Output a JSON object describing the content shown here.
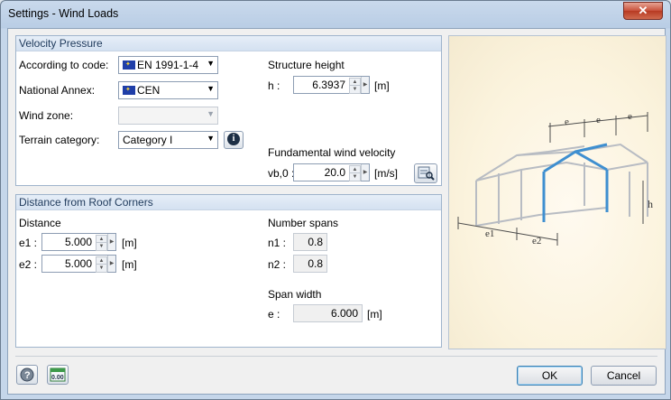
{
  "window": {
    "title": "Settings - Wind Loads",
    "close_glyph": "✕"
  },
  "velocity_pressure": {
    "header": "Velocity Pressure",
    "code_label": "According to code:",
    "code_value": "EN 1991-1-4",
    "annex_label": "National Annex:",
    "annex_value": "CEN",
    "zone_label": "Wind zone:",
    "zone_value": "",
    "terrain_label": "Terrain category:",
    "terrain_value": "Category I",
    "height_title": "Structure height",
    "h_label": "h :",
    "h_value": "6.3937",
    "h_unit": "[m]",
    "fund_title": "Fundamental wind velocity",
    "vb0_label": "vb,0 :",
    "vb0_value": "20.0",
    "vb0_unit": "[m/s]"
  },
  "roof_corners": {
    "header": "Distance from Roof Corners",
    "distance_title": "Distance",
    "e1_label": "e1 :",
    "e1_value": "5.000",
    "e1_unit": "[m]",
    "e2_label": "e2 :",
    "e2_value": "5.000",
    "e2_unit": "[m]",
    "spans_title": "Number spans",
    "n1_label": "n1 :",
    "n1_value": "0.8",
    "n2_label": "n2 :",
    "n2_value": "0.8",
    "span_width_title": "Span width",
    "e_label": "e :",
    "e_value": "6.000",
    "e_unit": "[m]"
  },
  "figure": {
    "e_top1": "e",
    "e_top2": "e",
    "e_top3": "e",
    "h": "h",
    "e1": "e1",
    "e2": "e2"
  },
  "buttons": {
    "ok": "OK",
    "cancel": "Cancel"
  },
  "icons": {
    "help": "help-icon",
    "units": "units-icon",
    "info": "info-icon",
    "calc": "calculator-icon",
    "flag": "eu-flag-icon"
  },
  "colors": {
    "accent_blue": "#3f8fd0",
    "group_header": "#1e395b"
  }
}
